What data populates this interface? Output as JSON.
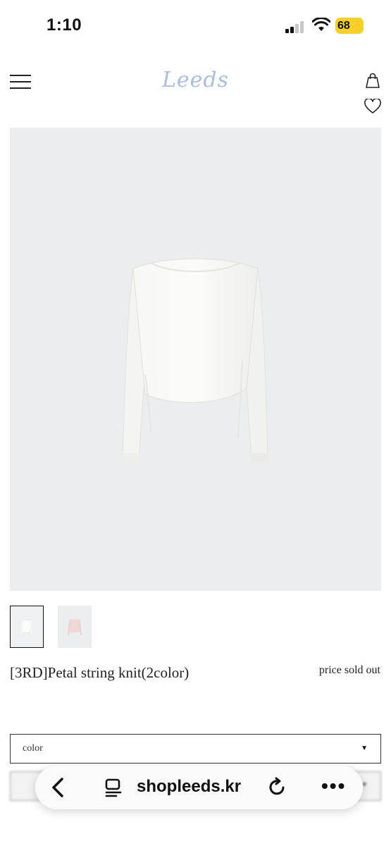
{
  "status_bar": {
    "time": "1:10",
    "battery": "68",
    "icons": [
      "signal-icon",
      "wifi-icon",
      "battery-icon"
    ]
  },
  "header": {
    "logo": "Leeds",
    "icons": [
      "menu-icon",
      "shopping-bag-icon",
      "heart-icon"
    ]
  },
  "product": {
    "title": "[3RD]Petal string knit(2color)",
    "price": "price sold out",
    "thumbnails": [
      "ivory",
      "pink"
    ]
  },
  "options": {
    "color_label": "color"
  },
  "browser": {
    "url": "shopleeds.kr",
    "icons": [
      "back-arrow-icon",
      "tabs-icon",
      "reload-icon",
      "more-icon"
    ]
  },
  "colors": {
    "logo": "#a9bde0",
    "battery": "#f4d02a",
    "image_bg": "#ebedef"
  }
}
